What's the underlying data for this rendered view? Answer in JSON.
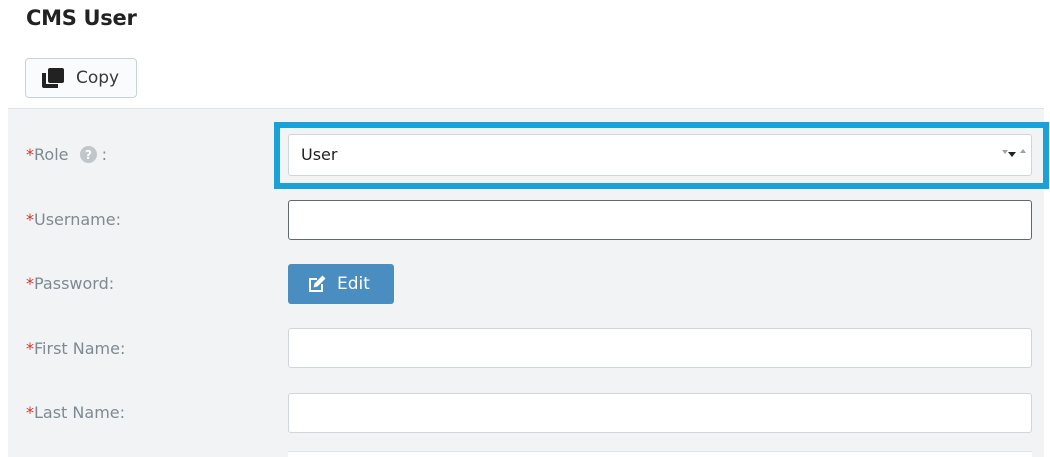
{
  "page": {
    "title": "CMS User"
  },
  "toolbar": {
    "copy_label": "Copy"
  },
  "form": {
    "required_marker": "*",
    "role": {
      "label": "Role",
      "suffix": ":",
      "value": "User"
    },
    "username": {
      "label": "Username:",
      "value": ""
    },
    "password": {
      "label": "Password:",
      "edit_label": "Edit"
    },
    "first_name": {
      "label": "First Name:",
      "value": ""
    },
    "last_name": {
      "label": "Last Name:",
      "value": ""
    }
  },
  "colors": {
    "highlight": "#1aa2d8",
    "edit_button": "#4a8ec1",
    "required_marker": "#d0382b",
    "panel_bg": "#f1f3f4"
  },
  "icons": {
    "copy": "copy-icon",
    "help": "help-circle-icon",
    "edit": "edit-pencil-icon",
    "dropdown": "dropdown-arrows-icon"
  }
}
